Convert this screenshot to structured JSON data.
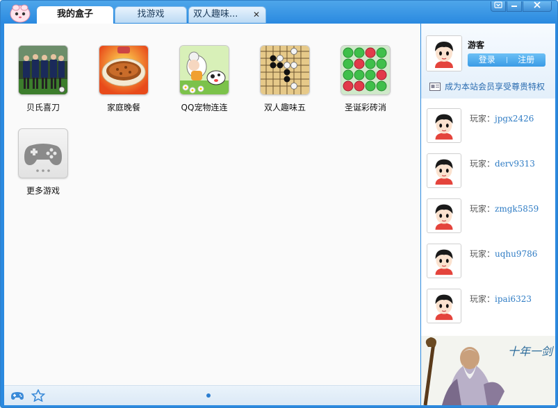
{
  "tabs": [
    {
      "label": "我的盒子",
      "active": true
    },
    {
      "label": "找游戏",
      "active": false
    },
    {
      "label": "双人趣味...",
      "active": false,
      "closable": true
    }
  ],
  "window_controls": [
    "menu-icon",
    "minimize-icon",
    "close-icon"
  ],
  "games": [
    {
      "name": "贝氏喜刀",
      "icon": "soccer-team-image"
    },
    {
      "name": "家庭晚餐",
      "icon": "pizza-dish-image"
    },
    {
      "name": "QQ宠物连连",
      "icon": "pet-animals-image"
    },
    {
      "name": "双人趣味五",
      "icon": "gomoku-board-image"
    },
    {
      "name": "圣诞彩砖消",
      "icon": "colored-balls-image"
    },
    {
      "name": "更多游戏",
      "icon": "gamepad-icon"
    }
  ],
  "user": {
    "name": "游客",
    "login_label": "登录",
    "register_label": "注册",
    "vip_text": "成为本站会员享受尊贵特权"
  },
  "players": [
    {
      "prefix": "玩家：",
      "name": "jpgx2426"
    },
    {
      "prefix": "玩家：",
      "name": "derv9313"
    },
    {
      "prefix": "玩家：",
      "name": "zmgk5859"
    },
    {
      "prefix": "玩家：",
      "name": "uqhu9786"
    },
    {
      "prefix": "玩家：",
      "name": "ipai6323"
    }
  ],
  "colors": {
    "accent": "#2b8ae0",
    "link": "#2f7cc4",
    "button": "#3a9be6"
  }
}
